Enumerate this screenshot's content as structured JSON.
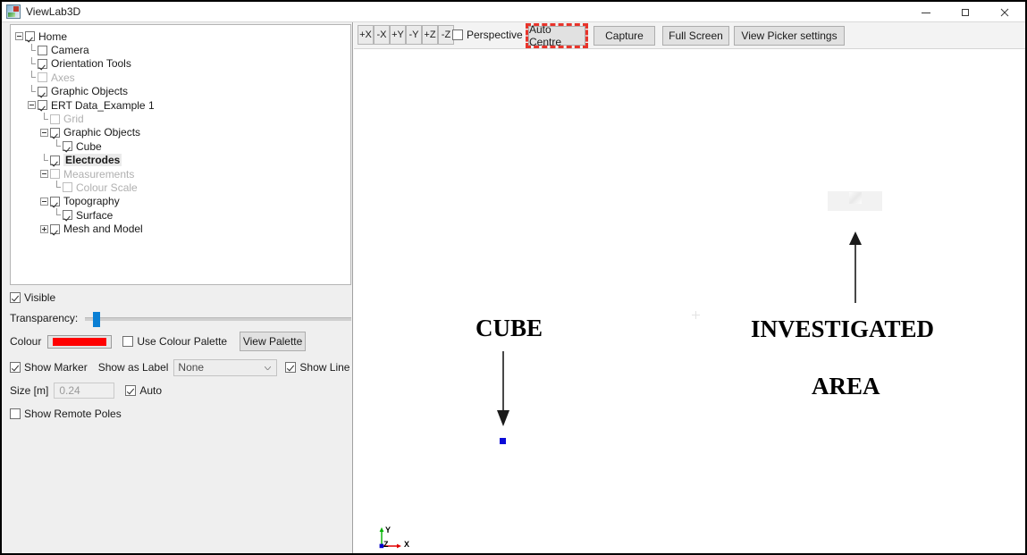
{
  "window": {
    "title": "ViewLab3D",
    "icon": "app-icon",
    "minimize": "—",
    "maximize": "❒",
    "close": "✕"
  },
  "tree": {
    "items": [
      {
        "label": "Home",
        "indent": 0,
        "checked": true,
        "dim": false,
        "bold": false,
        "expander": "minus"
      },
      {
        "label": "Camera",
        "indent": 1,
        "checked": false,
        "dim": false,
        "bold": false,
        "expander": "none"
      },
      {
        "label": "Orientation Tools",
        "indent": 1,
        "checked": true,
        "dim": false,
        "bold": false,
        "expander": "none"
      },
      {
        "label": "Axes",
        "indent": 1,
        "checked": false,
        "dim": true,
        "bold": false,
        "expander": "none"
      },
      {
        "label": "Graphic Objects",
        "indent": 1,
        "checked": true,
        "dim": false,
        "bold": false,
        "expander": "none"
      },
      {
        "label": "ERT Data_Example 1",
        "indent": 1,
        "checked": true,
        "dim": false,
        "bold": false,
        "expander": "minus"
      },
      {
        "label": "Grid",
        "indent": 2,
        "checked": false,
        "dim": true,
        "bold": false,
        "expander": "none"
      },
      {
        "label": "Graphic Objects",
        "indent": 2,
        "checked": true,
        "dim": false,
        "bold": false,
        "expander": "minus"
      },
      {
        "label": "Cube",
        "indent": 3,
        "checked": true,
        "dim": false,
        "bold": false,
        "expander": "none"
      },
      {
        "label": "Electrodes",
        "indent": 2,
        "checked": true,
        "dim": false,
        "bold": true,
        "expander": "none"
      },
      {
        "label": "Measurements",
        "indent": 2,
        "checked": false,
        "dim": true,
        "bold": false,
        "expander": "minus"
      },
      {
        "label": "Colour Scale",
        "indent": 3,
        "checked": false,
        "dim": true,
        "bold": false,
        "expander": "none"
      },
      {
        "label": "Topography",
        "indent": 2,
        "checked": true,
        "dim": false,
        "bold": false,
        "expander": "minus"
      },
      {
        "label": "Surface",
        "indent": 3,
        "checked": true,
        "dim": false,
        "bold": false,
        "expander": "none"
      },
      {
        "label": "Mesh and Model",
        "indent": 2,
        "checked": true,
        "dim": false,
        "bold": false,
        "expander": "plus"
      }
    ]
  },
  "properties": {
    "visible_label": "Visible",
    "visible_checked": true,
    "transparency_label": "Transparency:",
    "transparency_value": 3,
    "colour_label": "Colour",
    "colour_value": "#FF0000",
    "use_colour_palette_label": "Use Colour Palette",
    "use_colour_palette_checked": false,
    "view_palette_label": "View Palette",
    "show_marker_label": "Show Marker",
    "show_marker_checked": true,
    "show_as_label_label": "Show as Label",
    "show_as_label_value": "None",
    "show_line_label": "Show Line",
    "show_line_checked": true,
    "size_label": "Size [m]",
    "size_value": "0.24",
    "auto_label": "Auto",
    "auto_checked": true,
    "show_remote_poles_label": "Show Remote Poles",
    "show_remote_poles_checked": false
  },
  "toolbar": {
    "axis_buttons": [
      "+X",
      "-X",
      "+Y",
      "-Y",
      "+Z",
      "-Z"
    ],
    "perspective_label": "Perspective",
    "perspective_checked": false,
    "auto_centre_label": "Auto Centre",
    "capture_label": "Capture",
    "full_screen_label": "Full Screen",
    "view_picker_label": "View Picker settings",
    "highlight_colour": "#E8342B"
  },
  "viewport": {
    "annotation_cube": "CUBE",
    "annotation_investigated_1": "INVESTIGATED",
    "annotation_investigated_2": "AREA",
    "electrode_colour": "#0B0BD8",
    "axes": {
      "x": "X",
      "y": "Y",
      "z": "Z"
    }
  }
}
